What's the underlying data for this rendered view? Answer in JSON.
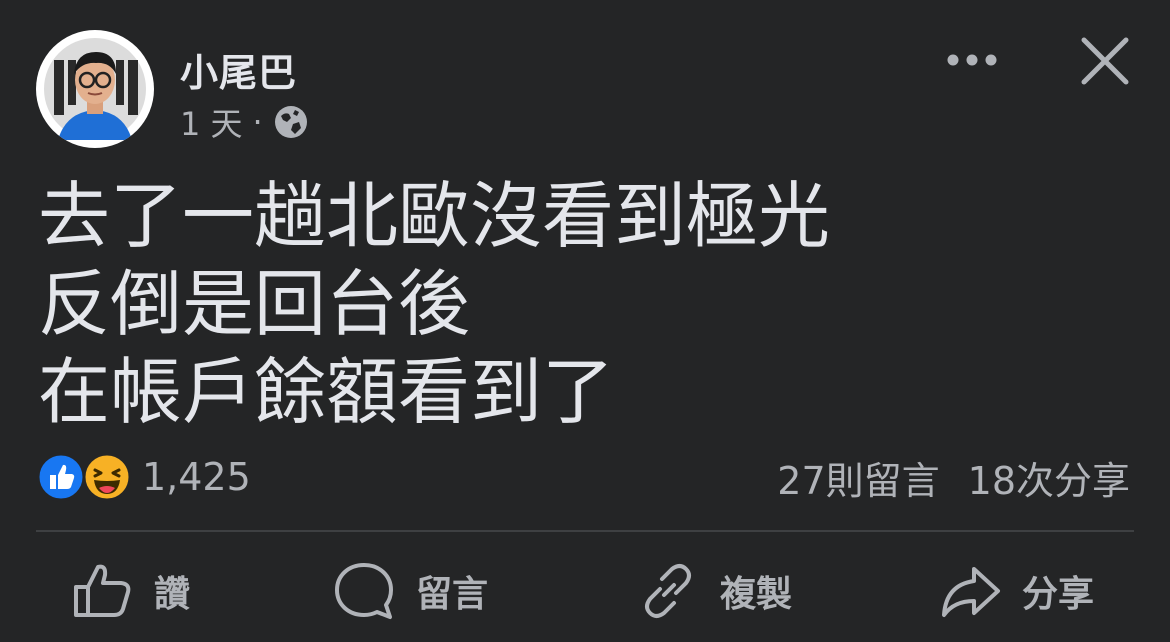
{
  "post": {
    "author": "小尾巴",
    "time": "1 天",
    "separator": "·",
    "privacy_icon": "globe-icon",
    "lines": [
      "去了一趟北歐沒看到極光",
      "反倒是回台後",
      "在帳戶餘額看到了"
    ]
  },
  "header": {
    "more_icon": "more-icon",
    "close_icon": "close-icon"
  },
  "reactions": {
    "icons": [
      "like-icon",
      "haha-icon"
    ],
    "count": "1,425"
  },
  "stats": {
    "comments": "27則留言",
    "shares": "18次分享"
  },
  "actions": [
    {
      "label": "讚",
      "icon": "thumbs-up-icon"
    },
    {
      "label": "留言",
      "icon": "comment-icon"
    },
    {
      "label": "複製",
      "icon": "link-icon"
    },
    {
      "label": "分享",
      "icon": "share-icon"
    }
  ],
  "colors": {
    "background": "#242526",
    "text_primary": "#e4e6eb",
    "text_secondary": "#b0b3b8",
    "like_blue": "#1877f2",
    "haha_yellow": "#f7b125"
  }
}
